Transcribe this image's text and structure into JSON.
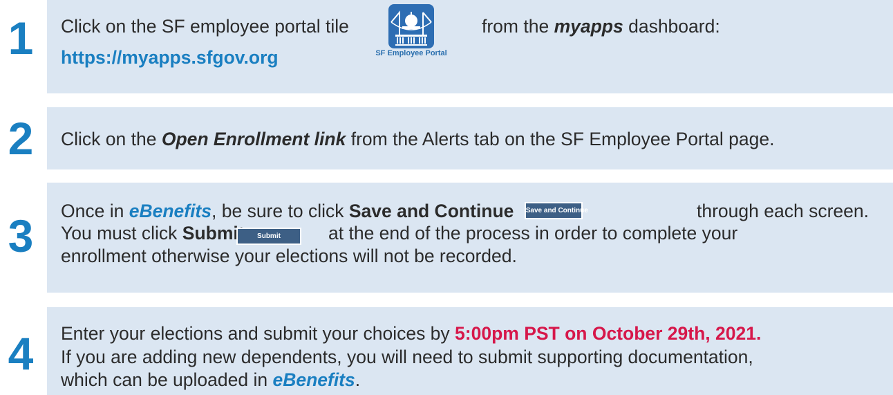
{
  "steps": [
    {
      "number": "1",
      "line1_pre": "Click on the SF employee portal tile",
      "line1_mid": "from the ",
      "line1_em": "myapps",
      "line1_post": " dashboard:",
      "link": "https://myapps.sfgov.org",
      "tile_label": "SF Employee Portal"
    },
    {
      "number": "2",
      "pre": "Click on the ",
      "em": "Open Enrollment link",
      "post": " from the Alerts tab on the SF Employee Portal page."
    },
    {
      "number": "3",
      "l1_pre": "Once in ",
      "l1_em": "eBenefits",
      "l1_mid": ", be sure to click ",
      "l1_bold": "Save and Continue",
      "l1_post": "through each screen.",
      "save_button": "Save and Continue",
      "l2_pre": "You must click ",
      "l2_bold": "Submit",
      "l2_post": "at the end of the process in order to complete your",
      "submit_button": "Submit",
      "l3": "enrollment otherwise your elections will not be recorded."
    },
    {
      "number": "4",
      "l1_pre": "Enter your elections and submit your choices by ",
      "deadline": "5:00pm PST on October 29th, 2021.",
      "l2": "If you are adding new dependents, you will need to submit supporting documentation,",
      "l3_pre": "which can be uploaded in ",
      "l3_em": "eBenefits",
      "l3_post": "."
    }
  ]
}
